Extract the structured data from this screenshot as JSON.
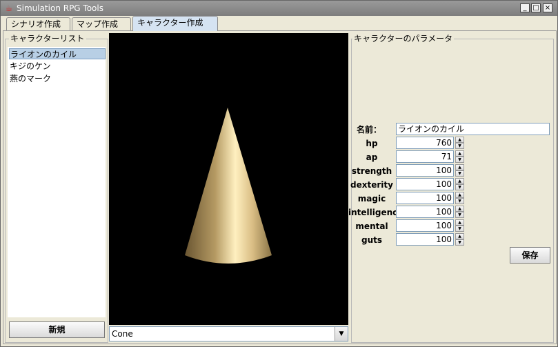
{
  "window": {
    "title": "Simulation RPG Tools",
    "minimize": "_",
    "maximize": "□",
    "close": "×"
  },
  "tabs": [
    {
      "label": "シナリオ作成"
    },
    {
      "label": "マップ作成"
    },
    {
      "label": "キャラクター作成"
    }
  ],
  "active_tab": 2,
  "character_list": {
    "title": "キャラクターリスト",
    "items": [
      {
        "label": "ライオンのカイル",
        "selected": true
      },
      {
        "label": "キジのケン",
        "selected": false
      },
      {
        "label": "燕のマーク",
        "selected": false
      }
    ],
    "new_button": "新規"
  },
  "viewer": {
    "shape": "Cone",
    "background": "#000000",
    "object_color": "#c8a86b"
  },
  "params": {
    "title": "キャラクターのパラメータ",
    "name_label": "名前：",
    "name_value": "ライオンのカイル",
    "fields": [
      {
        "label": "hp",
        "value": "760"
      },
      {
        "label": "ap",
        "value": "71"
      },
      {
        "label": "strength",
        "value": "100"
      },
      {
        "label": "dexterity",
        "value": "100"
      },
      {
        "label": "magic",
        "value": "100"
      },
      {
        "label": "intelligence",
        "value": "100"
      },
      {
        "label": "mental",
        "value": "100"
      },
      {
        "label": "guts",
        "value": "100"
      }
    ],
    "save_button": "保存"
  }
}
